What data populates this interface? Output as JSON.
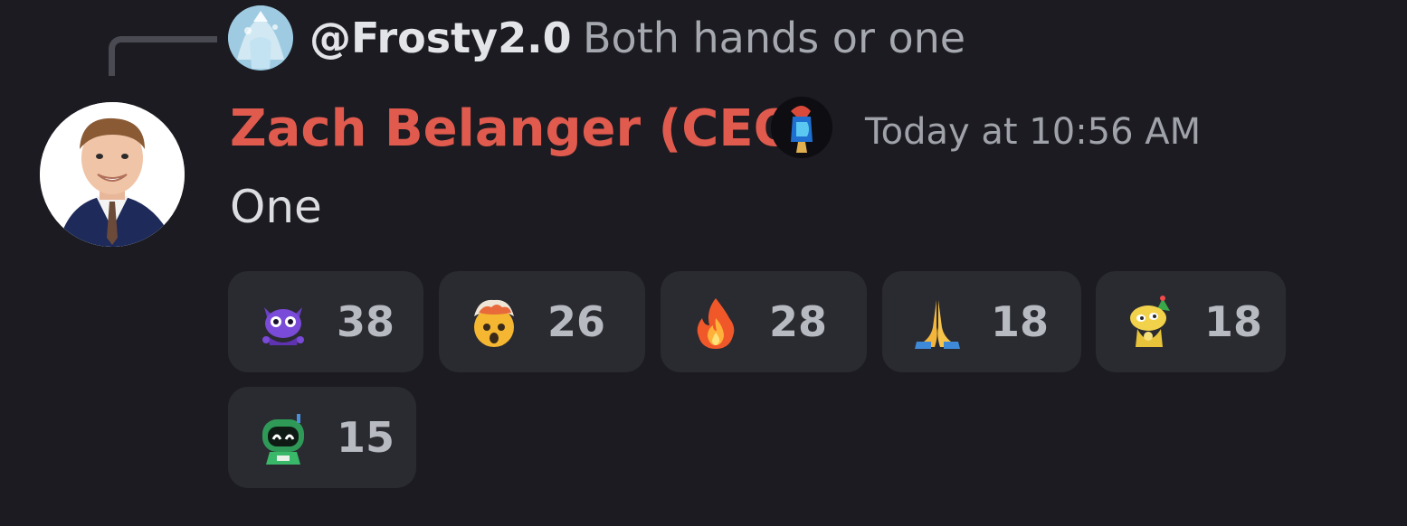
{
  "reply": {
    "author": "@Frosty2.0",
    "text": "Both hands or one"
  },
  "message": {
    "author": "Zach Belanger (CEO)",
    "author_color": "#e05a4e",
    "timestamp": "Today at 10:56 AM",
    "content": "One"
  },
  "reactions": [
    {
      "emoji": "purple-cat-emoji",
      "count": "38"
    },
    {
      "emoji": "exploding-head-emoji",
      "count": "26"
    },
    {
      "emoji": "fire-emoji",
      "count": "28"
    },
    {
      "emoji": "folded-hands-emoji",
      "count": "18"
    },
    {
      "emoji": "yellow-party-creature-emoji",
      "count": "18"
    },
    {
      "emoji": "green-robot-emoji",
      "count": "15"
    }
  ],
  "colors": {
    "background": "#1b1b21",
    "reaction_bg": "#2a2a31",
    "reply_line": "#4a4b52"
  }
}
